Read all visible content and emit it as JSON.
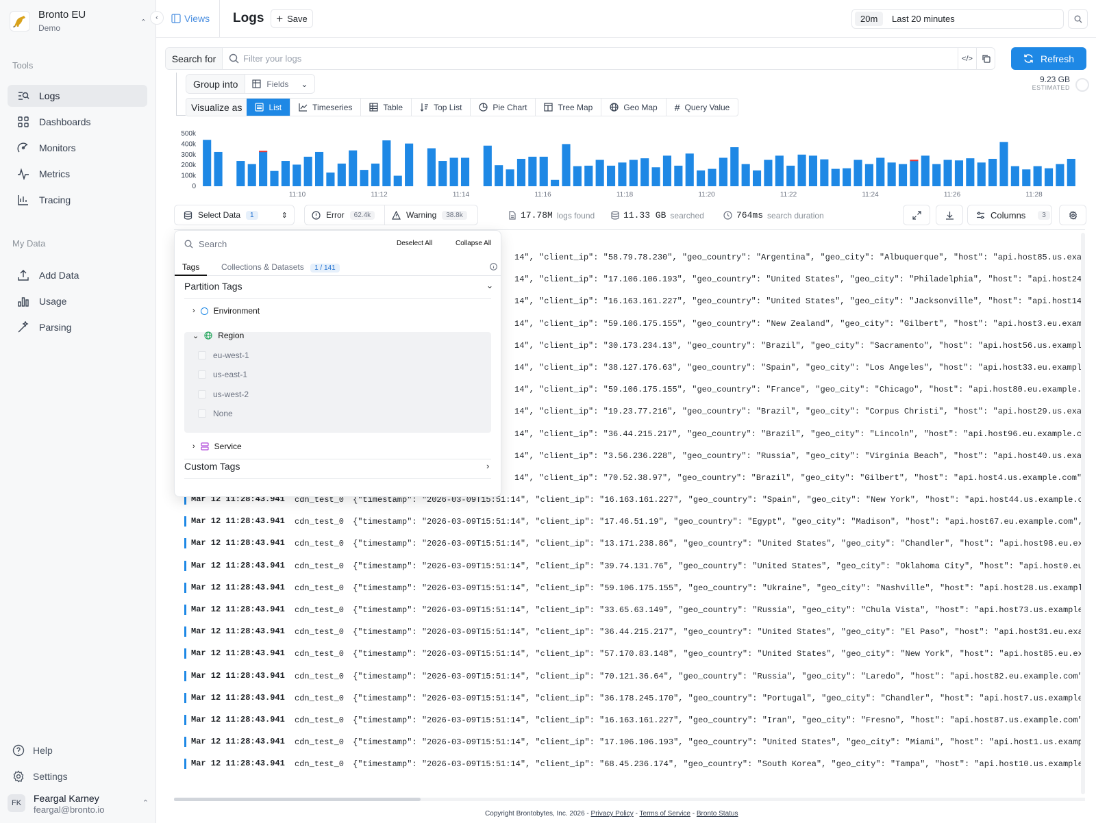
{
  "sidebar": {
    "org_name": "Bronto EU",
    "org_sub": "Demo",
    "tools_title": "Tools",
    "tools": [
      {
        "label": "Logs",
        "icon": "logs-icon",
        "active": true
      },
      {
        "label": "Dashboards",
        "icon": "dashboards-icon"
      },
      {
        "label": "Monitors",
        "icon": "monitors-icon"
      },
      {
        "label": "Metrics",
        "icon": "metrics-icon"
      },
      {
        "label": "Tracing",
        "icon": "tracing-icon"
      }
    ],
    "mydata_title": "My Data",
    "mydata": [
      {
        "label": "Add Data",
        "icon": "upload-icon"
      },
      {
        "label": "Usage",
        "icon": "usage-icon"
      },
      {
        "label": "Parsing",
        "icon": "parsing-icon"
      }
    ],
    "help": "Help",
    "settings": "Settings",
    "user": {
      "initials": "FK",
      "name": "Feargal Karney",
      "email": "feargal@bronto.io"
    }
  },
  "topbar": {
    "views": "Views",
    "title": "Logs",
    "save": "Save",
    "time_short": "20m",
    "time_long": "Last 20 minutes"
  },
  "search": {
    "label": "Search for",
    "placeholder": "Filter your logs",
    "refresh": "Refresh",
    "estimate_value": "9.23 GB",
    "estimate_label": "ESTIMATED"
  },
  "group": {
    "label": "Group into",
    "field": "Fields"
  },
  "visualize": {
    "label": "Visualize as",
    "options": [
      "List",
      "Timeseries",
      "Table",
      "Top List",
      "Pie Chart",
      "Tree Map",
      "Geo Map",
      "Query Value"
    ]
  },
  "chart_data": {
    "type": "bar",
    "y_ticks": [
      "500k",
      "400k",
      "300k",
      "200k",
      "100k",
      "0"
    ],
    "ylim": [
      0,
      500000
    ],
    "x_ticks": [
      "11:10",
      "11:12",
      "11:14",
      "11:16",
      "11:18",
      "11:20",
      "11:22",
      "11:24",
      "11:26",
      "11:28"
    ],
    "series_color": "#1e88e5",
    "error_color": "#e53935",
    "values": [
      440000,
      325000,
      0,
      240000,
      210000,
      330000,
      145000,
      240000,
      205000,
      280000,
      325000,
      130000,
      215000,
      340000,
      155000,
      215000,
      435000,
      100000,
      405000,
      0,
      360000,
      240000,
      270000,
      270000,
      0,
      385000,
      200000,
      160000,
      260000,
      280000,
      280000,
      60000,
      400000,
      190000,
      195000,
      250000,
      195000,
      225000,
      250000,
      265000,
      180000,
      290000,
      195000,
      310000,
      150000,
      165000,
      270000,
      370000,
      210000,
      150000,
      250000,
      290000,
      195000,
      300000,
      290000,
      255000,
      165000,
      170000,
      250000,
      210000,
      270000,
      225000,
      210000,
      245000,
      290000,
      210000,
      250000,
      245000,
      265000,
      225000,
      260000,
      420000,
      190000,
      160000,
      190000,
      170000,
      210000,
      260000
    ],
    "error_values": {
      "5": 22000,
      "63": 30000
    }
  },
  "stats": {
    "select_data": "Select Data",
    "select_count": "1",
    "error_label": "Error",
    "error_count": "62.4k",
    "warning_label": "Warning",
    "warning_count": "38.8k",
    "logs_found_value": "17.78M",
    "logs_found_label": "logs found",
    "searched_value": "11.33 GB",
    "searched_label": "searched",
    "duration_value": "764ms",
    "duration_label": "search duration",
    "columns_label": "Columns",
    "columns_count": "3"
  },
  "dropdown": {
    "search_placeholder": "Search",
    "deselect": "Deselect All",
    "collapse": "Collapse All",
    "tab_tags": "Tags",
    "tab_collections": "Collections & Datasets",
    "collections_count": "1 / 141",
    "partition_title": "Partition Tags",
    "environment": "Environment",
    "region": "Region",
    "region_options": [
      "eu-west-1",
      "us-east-1",
      "us-west-2",
      "None"
    ],
    "service": "Service",
    "custom_title": "Custom Tags"
  },
  "logs": {
    "partial_rows": [
      "14\", \"client_ip\": \"58.79.78.230\", \"geo_country\": \"Argentina\", \"geo_city\": \"Albuquerque\", \"host\": \"api.host85.us.example.com\",",
      "14\", \"client_ip\": \"17.106.106.193\", \"geo_country\": \"United States\", \"geo_city\": \"Philadelphia\", \"host\": \"api.host24.eu.exampl",
      "14\", \"client_ip\": \"16.163.161.227\", \"geo_country\": \"United States\", \"geo_city\": \"Jacksonville\", \"host\": \"api.host14.us.exampl",
      "14\", \"client_ip\": \"59.106.175.155\", \"geo_country\": \"New Zealand\", \"geo_city\": \"Gilbert\", \"host\": \"api.host3.eu.example.com\",",
      "14\", \"client_ip\": \"30.173.234.13\", \"geo_country\": \"Brazil\", \"geo_city\": \"Sacramento\", \"host\": \"api.host56.us.example.com\", \"u",
      "14\", \"client_ip\": \"38.127.176.63\", \"geo_country\": \"Spain\", \"geo_city\": \"Los Angeles\", \"host\": \"api.host33.eu.example.com\", \"u",
      "14\", \"client_ip\": \"59.106.175.155\", \"geo_country\": \"France\", \"geo_city\": \"Chicago\", \"host\": \"api.host80.eu.example.com\", \"url",
      "14\", \"client_ip\": \"19.23.77.216\", \"geo_country\": \"Brazil\", \"geo_city\": \"Corpus Christi\", \"host\": \"api.host29.us.example.com\",",
      "14\", \"client_ip\": \"36.44.215.217\", \"geo_country\": \"Brazil\", \"geo_city\": \"Lincoln\", \"host\": \"api.host96.eu.example.com\", \"url'",
      "14\", \"client_ip\": \"3.56.236.228\", \"geo_country\": \"Russia\", \"geo_city\": \"Virginia Beach\", \"host\": \"api.host40.us.example.com\",",
      "14\", \"client_ip\": \"70.52.38.97\", \"geo_country\": \"Brazil\", \"geo_city\": \"Gilbert\", \"host\": \"api.host4.us.example.com\", \"url\": \""
    ],
    "timestamp": "Mar 12 11:28:43.941",
    "dataset": "cdn_test_0",
    "prefix": "{\"timestamp\": \"2026-03-09T15:51:14\", ",
    "rows": [
      "\"client_ip\": \"16.163.161.227\", \"geo_country\": \"Spain\", \"geo_city\": \"New York\", \"host\": \"api.host44.us.example.com\", \"url",
      "\"client_ip\": \"17.46.51.19\", \"geo_country\": \"Egypt\", \"geo_city\": \"Madison\", \"host\": \"api.host67.eu.example.com\", \"url\": '",
      "\"client_ip\": \"13.171.238.86\", \"geo_country\": \"United States\", \"geo_city\": \"Chandler\", \"host\": \"api.host98.eu.example.com",
      "\"client_ip\": \"39.74.131.76\", \"geo_country\": \"United States\", \"geo_city\": \"Oklahoma City\", \"host\": \"api.host0.eu.example.",
      "\"client_ip\": \"59.106.175.155\", \"geo_country\": \"Ukraine\", \"geo_city\": \"Nashville\", \"host\": \"api.host28.us.example.com\", \"",
      "\"client_ip\": \"33.65.63.149\", \"geo_country\": \"Russia\", \"geo_city\": \"Chula Vista\", \"host\": \"api.host73.us.example.com\", \"u",
      "\"client_ip\": \"36.44.215.217\", \"geo_country\": \"United States\", \"geo_city\": \"El Paso\", \"host\": \"api.host31.eu.example.com'",
      "\"client_ip\": \"57.170.83.148\", \"geo_country\": \"United States\", \"geo_city\": \"New York\", \"host\": \"api.host85.eu.example.com",
      "\"client_ip\": \"70.121.36.64\", \"geo_country\": \"Russia\", \"geo_city\": \"Laredo\", \"host\": \"api.host82.eu.example.com\", \"url\":",
      "\"client_ip\": \"36.178.245.170\", \"geo_country\": \"Portugal\", \"geo_city\": \"Chandler\", \"host\": \"api.host7.us.example.com\", \"u",
      "\"client_ip\": \"16.163.161.227\", \"geo_country\": \"Iran\", \"geo_city\": \"Fresno\", \"host\": \"api.host87.us.example.com\", \"url\":",
      "\"client_ip\": \"17.106.106.193\", \"geo_country\": \"United States\", \"geo_city\": \"Miami\", \"host\": \"api.host1.us.example.com\",",
      "\"client_ip\": \"68.45.236.174\", \"geo_country\": \"South Korea\", \"geo_city\": \"Tampa\", \"host\": \"api.host10.us.example.com\", \"u"
    ]
  },
  "footer": {
    "copyright": "Copyright Brontobytes, Inc. 2026 -",
    "privacy": "Privacy Policy",
    "terms": "Terms of Service",
    "status": "Bronto Status",
    "sep": "-"
  }
}
